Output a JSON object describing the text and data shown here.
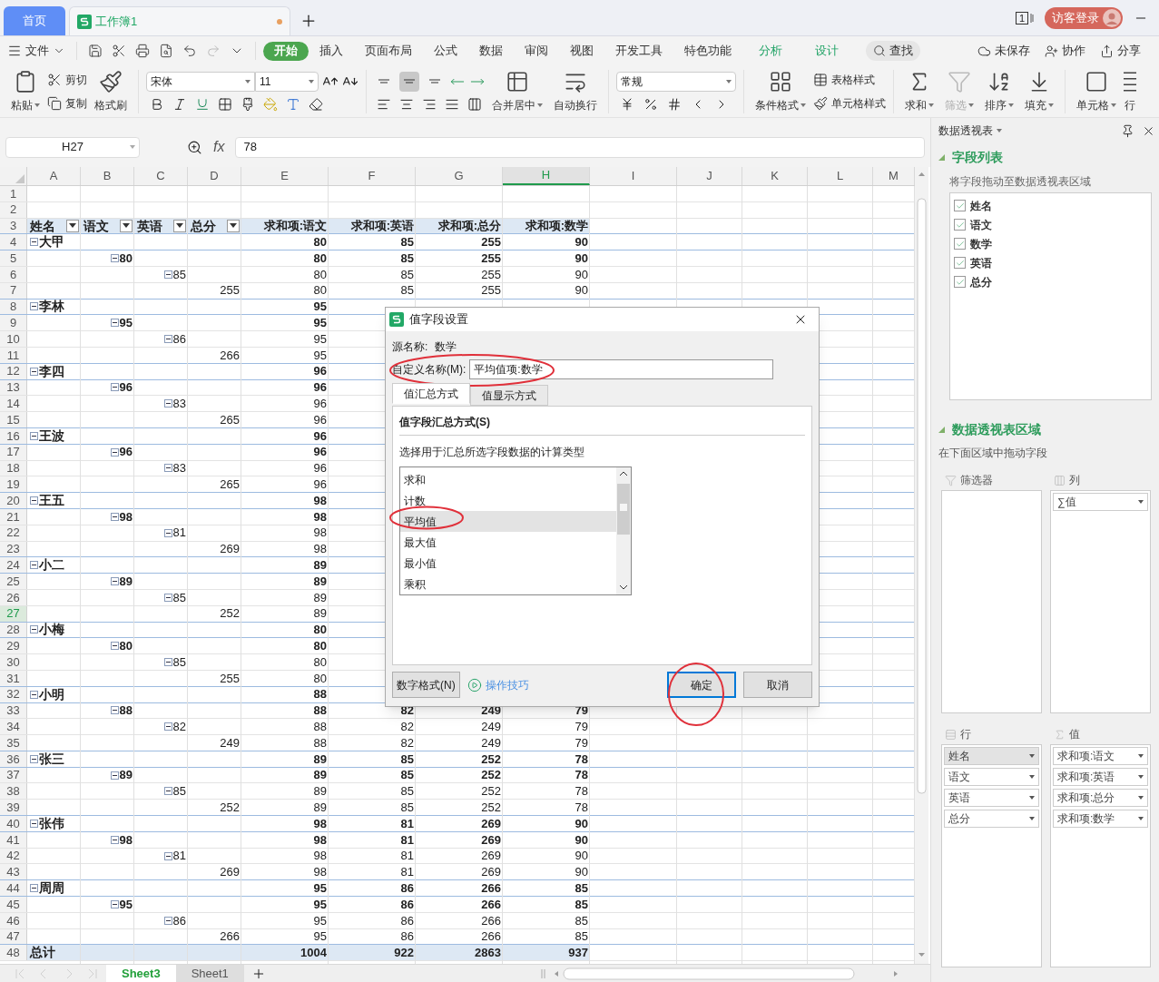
{
  "tabs_bar": {
    "tabs": [
      {
        "label": "首页",
        "kind": "home",
        "selected": false
      },
      {
        "label": "工作簿1",
        "kind": "doc",
        "selected": true,
        "modified": true
      }
    ],
    "page_count": "1",
    "login": "访客登录"
  },
  "menu": {
    "file": "文件",
    "tabs": [
      {
        "label": "开始",
        "selected": true,
        "contextual": false
      },
      {
        "label": "插入",
        "selected": false,
        "contextual": false
      },
      {
        "label": "页面布局",
        "selected": false,
        "contextual": false
      },
      {
        "label": "公式",
        "selected": false,
        "contextual": false
      },
      {
        "label": "数据",
        "selected": false,
        "contextual": false
      },
      {
        "label": "审阅",
        "selected": false,
        "contextual": false
      },
      {
        "label": "视图",
        "selected": false,
        "contextual": false
      },
      {
        "label": "开发工具",
        "selected": false,
        "contextual": false
      },
      {
        "label": "特色功能",
        "selected": false,
        "contextual": false
      },
      {
        "label": "分析",
        "selected": false,
        "contextual": true
      },
      {
        "label": "设计",
        "selected": false,
        "contextual": true
      }
    ],
    "search": "查找",
    "unsaved": "未保存",
    "collab": "协作",
    "share": "分享"
  },
  "ribbon": {
    "paste": "粘贴",
    "cut": "剪切",
    "copy": "复制",
    "format_painter": "格式刷",
    "font": "宋体",
    "font_size": "11",
    "valign": [
      {
        "selected": false
      },
      {
        "selected": true
      },
      {
        "selected": false
      }
    ],
    "merge": "合并居中",
    "wrap": "自动换行",
    "number_format": "常规",
    "conditional": "条件格式",
    "table_style": "表格样式",
    "cell_style": "单元格样式",
    "sum": {
      "label": "求和",
      "disabled": false
    },
    "filter": {
      "label": "筛选",
      "disabled": true
    },
    "sort": {
      "label": "排序",
      "disabled": false
    },
    "fill": {
      "label": "填充",
      "disabled": false
    },
    "cell": "单元格",
    "row_col": "行"
  },
  "formula_bar": {
    "cell": "H27",
    "fx": "fx",
    "value": "78"
  },
  "sheet": {
    "columns": [
      {
        "label": "A",
        "selected": false
      },
      {
        "label": "B",
        "selected": false
      },
      {
        "label": "C",
        "selected": false
      },
      {
        "label": "D",
        "selected": false
      },
      {
        "label": "E",
        "selected": false
      },
      {
        "label": "F",
        "selected": false
      },
      {
        "label": "G",
        "selected": false
      },
      {
        "label": "H",
        "selected": true
      },
      {
        "label": "I",
        "selected": false
      },
      {
        "label": "J",
        "selected": false
      },
      {
        "label": "K",
        "selected": false
      },
      {
        "label": "L",
        "selected": false
      },
      {
        "label": "M",
        "selected": false
      }
    ],
    "rows": [
      {
        "n": "1",
        "kind": "empty",
        "selected": false
      },
      {
        "n": "2",
        "kind": "empty",
        "selected": false
      },
      {
        "n": "3",
        "kind": "header",
        "selected": false,
        "fields": [
          "姓名",
          "语文",
          "英语",
          "总分"
        ],
        "values": [
          "求和项:语文",
          "求和项:英语",
          "求和项:总分",
          "求和项:数学"
        ]
      },
      {
        "n": "4",
        "kind": "name",
        "selected": false,
        "label": "大甲",
        "values": [
          "80",
          "85",
          "255",
          "90"
        ]
      },
      {
        "n": "5",
        "kind": "chinese",
        "selected": false,
        "label": "80",
        "values": [
          "80",
          "85",
          "255",
          "90"
        ]
      },
      {
        "n": "6",
        "kind": "english",
        "selected": false,
        "label": "85",
        "values": [
          "80",
          "85",
          "255",
          "90"
        ]
      },
      {
        "n": "7",
        "kind": "total",
        "selected": false,
        "label": "255",
        "values": [
          "80",
          "85",
          "255",
          "90"
        ]
      },
      {
        "n": "8",
        "kind": "name",
        "selected": false,
        "label": "李林",
        "values": [
          "95"
        ]
      },
      {
        "n": "9",
        "kind": "chinese",
        "selected": false,
        "label": "95",
        "values": [
          "95"
        ]
      },
      {
        "n": "10",
        "kind": "english",
        "selected": false,
        "label": "86",
        "values": [
          "95"
        ]
      },
      {
        "n": "11",
        "kind": "total",
        "selected": false,
        "label": "266",
        "values": [
          "95"
        ]
      },
      {
        "n": "12",
        "kind": "name",
        "selected": false,
        "label": "李四",
        "values": [
          "96"
        ]
      },
      {
        "n": "13",
        "kind": "chinese",
        "selected": false,
        "label": "96",
        "values": [
          "96"
        ]
      },
      {
        "n": "14",
        "kind": "english",
        "selected": false,
        "label": "83",
        "values": [
          "96"
        ]
      },
      {
        "n": "15",
        "kind": "total",
        "selected": false,
        "label": "265",
        "values": [
          "96"
        ]
      },
      {
        "n": "16",
        "kind": "name",
        "selected": false,
        "label": "王波",
        "values": [
          "96"
        ]
      },
      {
        "n": "17",
        "kind": "chinese",
        "selected": false,
        "label": "96",
        "values": [
          "96"
        ]
      },
      {
        "n": "18",
        "kind": "english",
        "selected": false,
        "label": "83",
        "values": [
          "96"
        ]
      },
      {
        "n": "19",
        "kind": "total",
        "selected": false,
        "label": "265",
        "values": [
          "96"
        ]
      },
      {
        "n": "20",
        "kind": "name",
        "selected": false,
        "label": "王五",
        "values": [
          "98"
        ]
      },
      {
        "n": "21",
        "kind": "chinese",
        "selected": false,
        "label": "98",
        "values": [
          "98"
        ]
      },
      {
        "n": "22",
        "kind": "english",
        "selected": false,
        "label": "81",
        "values": [
          "98"
        ]
      },
      {
        "n": "23",
        "kind": "total",
        "selected": false,
        "label": "269",
        "values": [
          "98"
        ]
      },
      {
        "n": "24",
        "kind": "name",
        "selected": false,
        "label": "小二",
        "values": [
          "89"
        ]
      },
      {
        "n": "25",
        "kind": "chinese",
        "selected": false,
        "label": "89",
        "values": [
          "89"
        ]
      },
      {
        "n": "26",
        "kind": "english",
        "selected": false,
        "label": "85",
        "values": [
          "89"
        ]
      },
      {
        "n": "27",
        "kind": "total",
        "selected": true,
        "label": "252",
        "values": [
          "89"
        ]
      },
      {
        "n": "28",
        "kind": "name",
        "selected": false,
        "label": "小梅",
        "values": [
          "80"
        ]
      },
      {
        "n": "29",
        "kind": "chinese",
        "selected": false,
        "label": "80",
        "values": [
          "80"
        ]
      },
      {
        "n": "30",
        "kind": "english",
        "selected": false,
        "label": "85",
        "values": [
          "80"
        ]
      },
      {
        "n": "31",
        "kind": "total",
        "selected": false,
        "label": "255",
        "values": [
          "80"
        ]
      },
      {
        "n": "32",
        "kind": "name",
        "selected": false,
        "label": "小明",
        "values": [
          "88"
        ]
      },
      {
        "n": "33",
        "kind": "chinese",
        "selected": false,
        "label": "88",
        "values": [
          "88",
          "82",
          "249",
          "79"
        ]
      },
      {
        "n": "34",
        "kind": "english",
        "selected": false,
        "label": "82",
        "values": [
          "88",
          "82",
          "249",
          "79"
        ]
      },
      {
        "n": "35",
        "kind": "total",
        "selected": false,
        "label": "249",
        "values": [
          "88",
          "82",
          "249",
          "79"
        ]
      },
      {
        "n": "36",
        "kind": "name",
        "selected": false,
        "label": "张三",
        "values": [
          "89",
          "85",
          "252",
          "78"
        ]
      },
      {
        "n": "37",
        "kind": "chinese",
        "selected": false,
        "label": "89",
        "values": [
          "89",
          "85",
          "252",
          "78"
        ]
      },
      {
        "n": "38",
        "kind": "english",
        "selected": false,
        "label": "85",
        "values": [
          "89",
          "85",
          "252",
          "78"
        ]
      },
      {
        "n": "39",
        "kind": "total",
        "selected": false,
        "label": "252",
        "values": [
          "89",
          "85",
          "252",
          "78"
        ]
      },
      {
        "n": "40",
        "kind": "name",
        "selected": false,
        "label": "张伟",
        "values": [
          "98",
          "81",
          "269",
          "90"
        ]
      },
      {
        "n": "41",
        "kind": "chinese",
        "selected": false,
        "label": "98",
        "values": [
          "98",
          "81",
          "269",
          "90"
        ]
      },
      {
        "n": "42",
        "kind": "english",
        "selected": false,
        "label": "81",
        "values": [
          "98",
          "81",
          "269",
          "90"
        ]
      },
      {
        "n": "43",
        "kind": "total",
        "selected": false,
        "label": "269",
        "values": [
          "98",
          "81",
          "269",
          "90"
        ]
      },
      {
        "n": "44",
        "kind": "name",
        "selected": false,
        "label": "周周",
        "values": [
          "95",
          "86",
          "266",
          "85"
        ]
      },
      {
        "n": "45",
        "kind": "chinese",
        "selected": false,
        "label": "95",
        "values": [
          "95",
          "86",
          "266",
          "85"
        ]
      },
      {
        "n": "46",
        "kind": "english",
        "selected": false,
        "label": "86",
        "values": [
          "95",
          "86",
          "266",
          "85"
        ]
      },
      {
        "n": "47",
        "kind": "total",
        "selected": false,
        "label": "266",
        "values": [
          "95",
          "86",
          "266",
          "85"
        ]
      },
      {
        "n": "48",
        "kind": "grand",
        "selected": false,
        "label": "总计",
        "values": [
          "1004",
          "922",
          "2863",
          "937"
        ]
      }
    ]
  },
  "sheet_tabs": [
    {
      "label": "Sheet3",
      "selected": true
    },
    {
      "label": "Sheet1",
      "selected": false
    }
  ],
  "dialog": {
    "title": "值字段设置",
    "source_label": "源名称:",
    "source_value": "数学",
    "custom_label": "自定义名称(M):",
    "custom_value": "平均值项:数学",
    "tabs": [
      {
        "label": "值汇总方式",
        "selected": true
      },
      {
        "label": "值显示方式",
        "selected": false
      }
    ],
    "group_title": "值字段汇总方式(S)",
    "hint": "选择用于汇总所选字段数据的计算类型",
    "options": [
      {
        "label": "求和",
        "selected": false
      },
      {
        "label": "计数",
        "selected": false
      },
      {
        "label": "平均值",
        "selected": true
      },
      {
        "label": "最大值",
        "selected": false
      },
      {
        "label": "最小值",
        "selected": false
      },
      {
        "label": "乘积",
        "selected": false
      }
    ],
    "number_format": "数字格式(N)",
    "tips": "操作技巧",
    "ok": "确定",
    "cancel": "取消"
  },
  "panel": {
    "title": "数据透视表",
    "field_section": "字段列表",
    "field_hint": "将字段拖动至数据透视表区域",
    "fields": [
      {
        "label": "姓名",
        "checked": true
      },
      {
        "label": "语文",
        "checked": true
      },
      {
        "label": "数学",
        "checked": true
      },
      {
        "label": "英语",
        "checked": true
      },
      {
        "label": "总分",
        "checked": true
      }
    ],
    "area_section": "数据透视表区域",
    "area_hint": "在下面区域中拖动字段",
    "top_areas": [
      {
        "kind": "filter",
        "title": "筛选器"
      },
      {
        "kind": "column",
        "title": "列",
        "items": [
          {
            "label": "∑值",
            "selected": false
          }
        ]
      }
    ],
    "bottom_areas": [
      {
        "kind": "row",
        "title": "行",
        "items": [
          {
            "label": "姓名",
            "selected": true
          },
          {
            "label": "语文",
            "selected": false
          },
          {
            "label": "英语",
            "selected": false
          },
          {
            "label": "总分",
            "selected": false
          }
        ]
      },
      {
        "kind": "value",
        "title": "值",
        "items": [
          {
            "label": "求和项:语文",
            "selected": false
          },
          {
            "label": "求和项:英语",
            "selected": false
          },
          {
            "label": "求和项:总分",
            "selected": false
          },
          {
            "label": "求和项:数学",
            "selected": false
          }
        ]
      }
    ]
  }
}
